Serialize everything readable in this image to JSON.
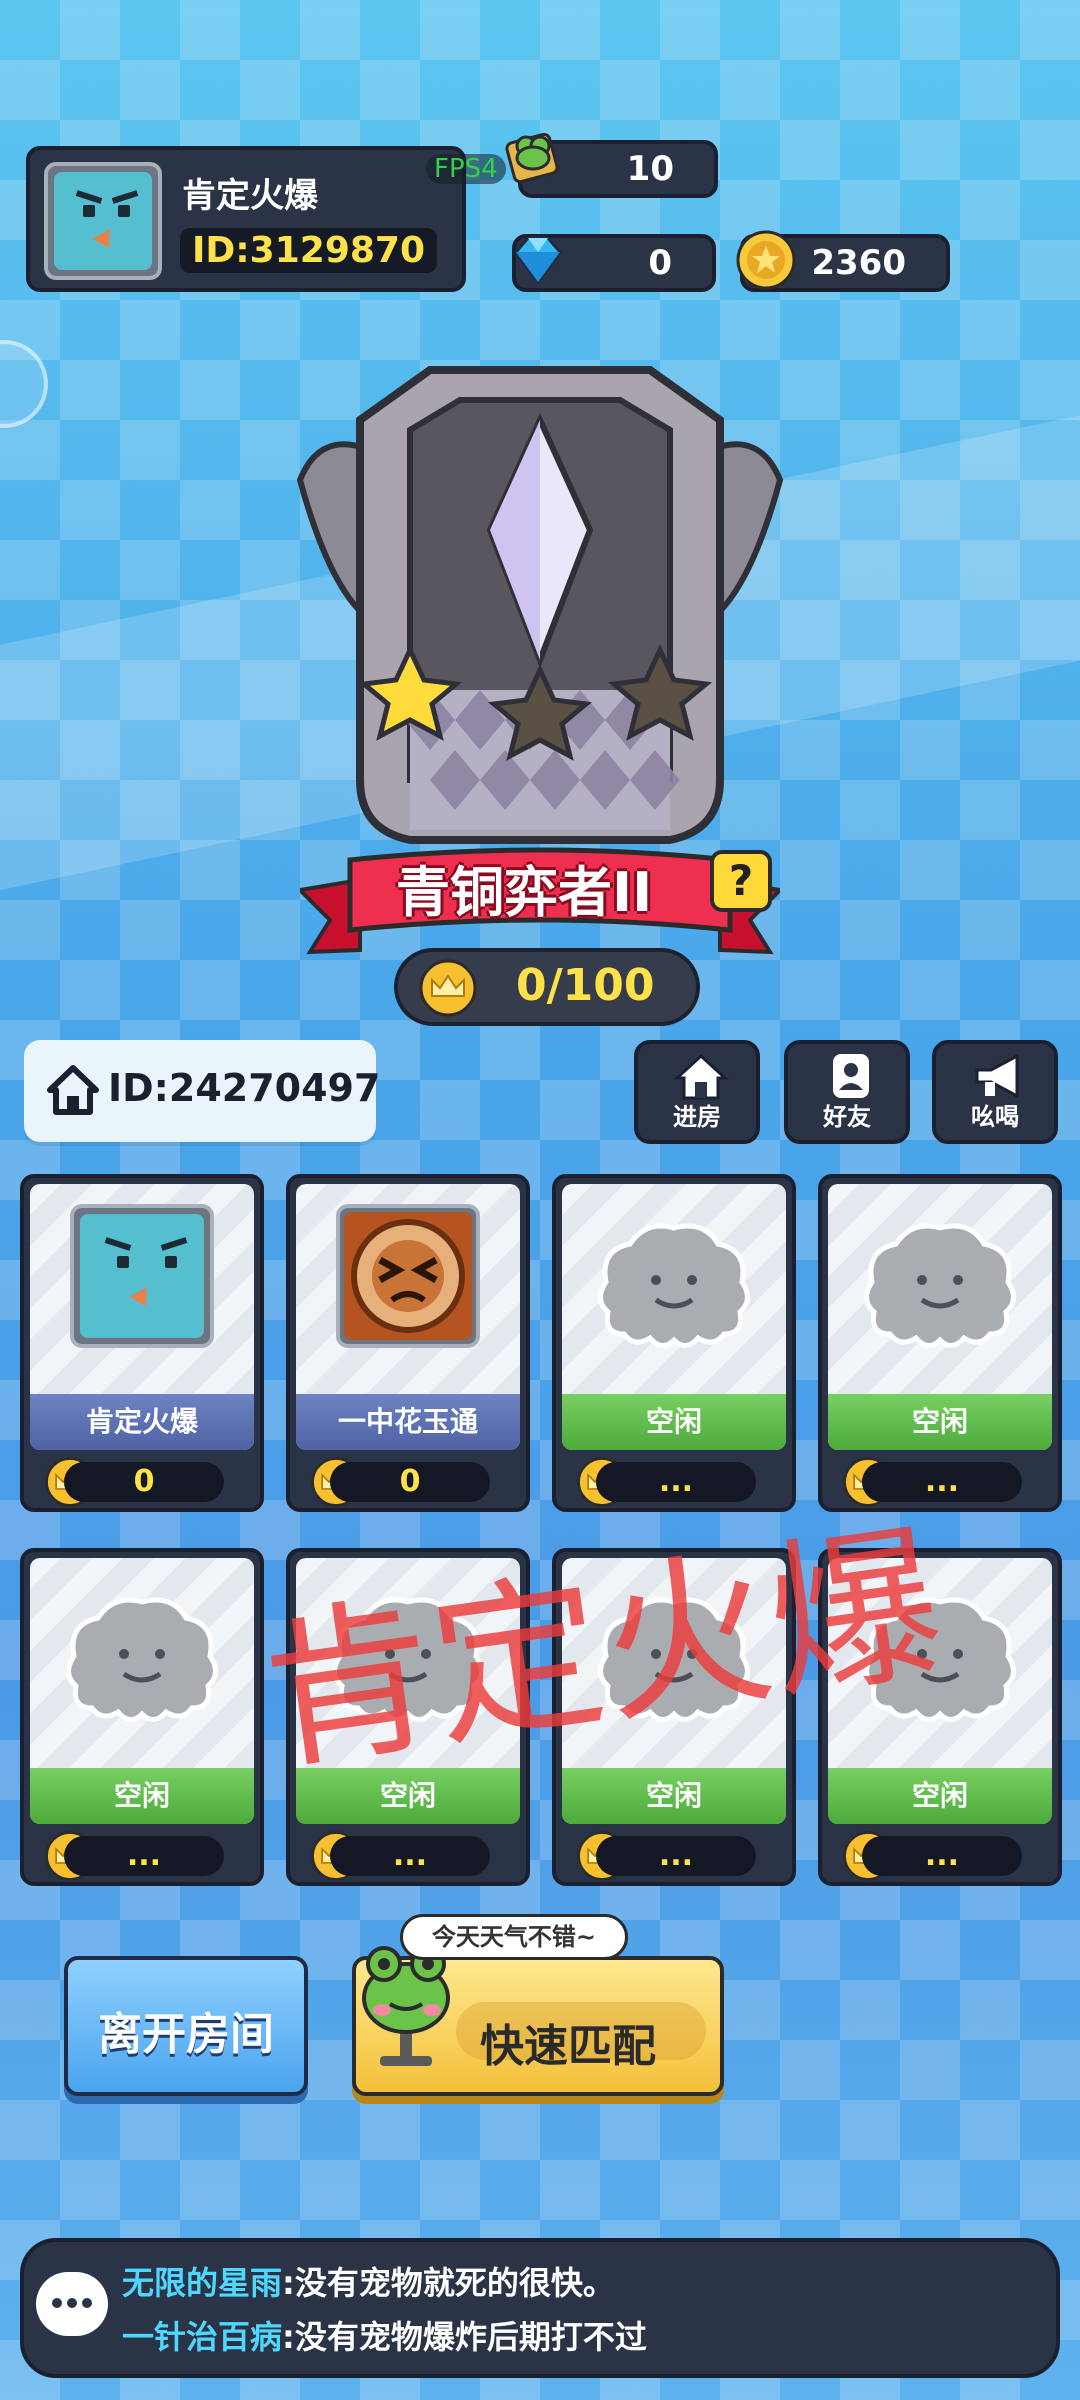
{
  "profile": {
    "name": "肯定火爆",
    "id": "ID:3129870"
  },
  "fps": "FPS4",
  "currency": {
    "frog_tickets": "10",
    "gems": "0",
    "gold": "2360"
  },
  "rank": {
    "title": "青铜弈者II",
    "help": "?",
    "progress_text": "0/100",
    "progress": 0,
    "stars_filled": 1,
    "stars_total": 3
  },
  "room": {
    "id": "ID:24270497"
  },
  "actions": [
    {
      "label": "进房",
      "icon": "house-icon"
    },
    {
      "label": "好友",
      "icon": "friends-icon"
    },
    {
      "label": "吆喝",
      "icon": "megaphone-icon"
    }
  ],
  "slots": [
    {
      "name": "肯定火爆",
      "score": "0",
      "state": "occupied",
      "avatar": "blue-cube"
    },
    {
      "name": "一中花玉通",
      "score": "0",
      "state": "occupied",
      "avatar": "brown-face"
    },
    {
      "name": "空闲",
      "score": "...",
      "state": "idle"
    },
    {
      "name": "空闲",
      "score": "...",
      "state": "idle"
    },
    {
      "name": "空闲",
      "score": "...",
      "state": "idle"
    },
    {
      "name": "空闲",
      "score": "...",
      "state": "idle"
    },
    {
      "name": "空闲",
      "score": "...",
      "state": "idle"
    },
    {
      "name": "空闲",
      "score": "...",
      "state": "idle"
    }
  ],
  "watermark": "肯定火爆",
  "buttons": {
    "leave": "离开房间",
    "quick_match": "快速匹配",
    "speech": "今天天气不错~"
  },
  "chat": [
    {
      "user": "无限的星雨",
      "text": ":没有宠物就死的很快。"
    },
    {
      "user": "一针治百病",
      "text": ":没有宠物爆炸后期打不过"
    }
  ],
  "colors": {
    "accent_gold": "#ffe24a",
    "idle_green": "#4cab3c",
    "occupied_blue": "#4e62a4",
    "panel": "#2b3346"
  }
}
